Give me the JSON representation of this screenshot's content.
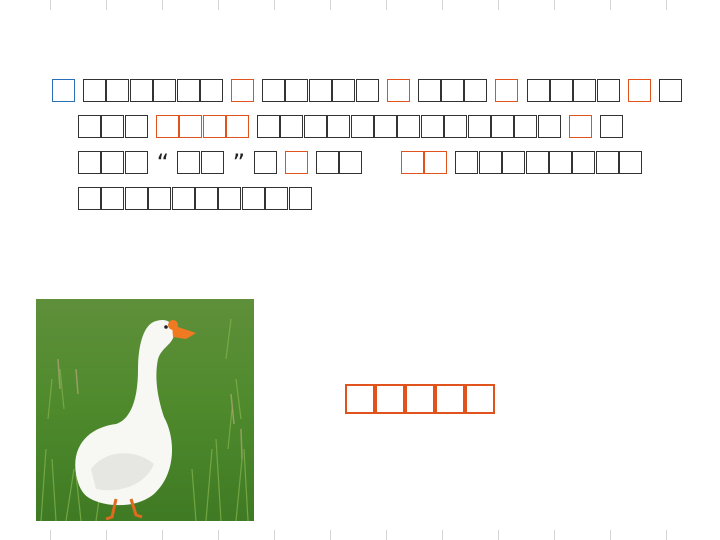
{
  "passage": {
    "colors": {
      "text": "#222222",
      "highlight": "#e0531c",
      "bullet": "#2a6fb8"
    },
    "line_1": {
      "open_quote": "",
      "close_quote": ""
    },
    "line_3": {
      "open_quote": "“",
      "close_quote": "”"
    }
  },
  "image": {
    "subject": "white-goose-on-grass"
  }
}
